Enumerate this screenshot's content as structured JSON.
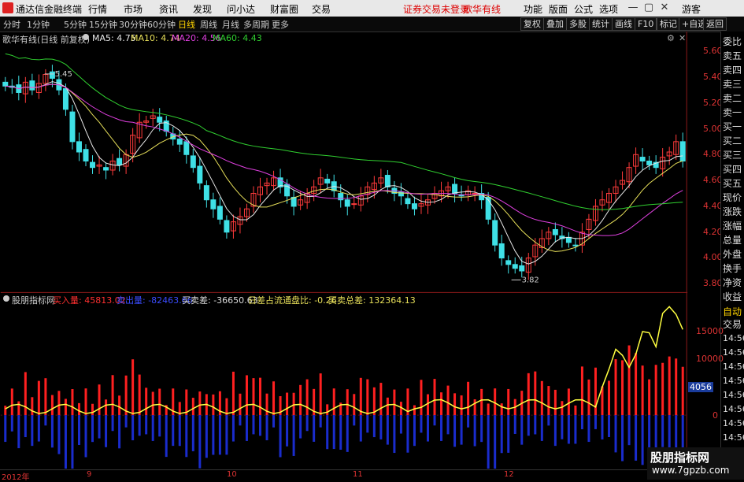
{
  "menubar": {
    "app_title": "通达信金融终端",
    "menus": [
      "行情",
      "市场",
      "资讯",
      "发现",
      "问小达",
      "财富圈",
      "交易"
    ],
    "notice": "证券交易未登录",
    "stock_name": "歌华有线",
    "right_menus": [
      "功能",
      "版面",
      "公式",
      "选项"
    ],
    "user": "游客"
  },
  "periodbar": {
    "periods": [
      "分时",
      "1分钟",
      "5分钟",
      "15分钟",
      "30分钟",
      "60分钟",
      "日线",
      "周线",
      "月线",
      "多周期",
      "更多"
    ],
    "active": "日线",
    "tools": [
      "复权",
      "叠加",
      "多股",
      "统计",
      "画线",
      "F10",
      "标记",
      "+自选",
      "返回"
    ]
  },
  "main_legend": {
    "title": "歌华有线(日线 前复权)",
    "ma5": "MA5: 4.75",
    "ma10": "MA10: 4.74",
    "ma20": "MA20: 4.56",
    "ma60": "MA60: 4.43",
    "high_label": "5.45",
    "low_label": "3.82"
  },
  "price_axis": [
    "5.60",
    "5.40",
    "5.20",
    "5.00",
    "4.80",
    "4.60",
    "4.40",
    "4.20",
    "4.00",
    "3.80"
  ],
  "right_panel": [
    "委比",
    "卖五",
    "卖四",
    "卖三",
    "卖二",
    "卖一",
    "买一",
    "买二",
    "买三",
    "买四",
    "买五",
    "现价",
    "涨跌",
    "涨幅",
    "总量",
    "外盘",
    "换手",
    "净资",
    "收益"
  ],
  "right_panel2": {
    "auto": "自动",
    "trade": "交易",
    "times": [
      "14:56",
      "14:56",
      "14:56",
      "14:56",
      "14:56",
      "14:56",
      "14:56",
      "14:56"
    ]
  },
  "indicator_legend": {
    "name": "股朋指标网",
    "buy": "买入量: 45813.02",
    "sell": "卖出量: -82463.66",
    "diff": "买卖差: -36650.63",
    "ratio": "日差占流通盘比: -0.26",
    "total": "买卖总差: 132364.13"
  },
  "indicator_axis": [
    "15000",
    "10000",
    "4056",
    "0"
  ],
  "date_axis": [
    "2012年",
    "9",
    "10",
    "11",
    "12"
  ],
  "watermark": {
    "line1": "股朋指标网",
    "line2": "www.7gpzb.com"
  },
  "colors": {
    "up": "#ff3b3b",
    "down": "#3fe0e6",
    "ma5": "#e8e8e8",
    "ma10": "#e8e05a",
    "ma20": "#e040e0",
    "ma60": "#30d030",
    "buy": "#ff2020",
    "sell": "#1a2ccc",
    "total": "#ffff40",
    "axis": "#d33"
  },
  "chart_data": {
    "type": "candlestick",
    "closes": [
      5.33,
      5.32,
      5.28,
      5.36,
      5.3,
      5.35,
      5.42,
      5.39,
      5.3,
      5.15,
      4.9,
      4.82,
      4.75,
      4.7,
      4.72,
      4.68,
      4.75,
      4.72,
      4.8,
      4.95,
      5.05,
      5.06,
      5.1,
      5.05,
      4.98,
      4.92,
      4.88,
      4.8,
      4.7,
      4.58,
      4.45,
      4.38,
      4.3,
      4.2,
      4.28,
      4.32,
      4.38,
      4.5,
      4.55,
      4.58,
      4.62,
      4.55,
      4.48,
      4.4,
      4.45,
      4.5,
      4.55,
      4.62,
      4.58,
      4.52,
      4.45,
      4.4,
      4.42,
      4.48,
      4.55,
      4.58,
      4.62,
      4.55,
      4.5,
      4.48,
      4.42,
      4.38,
      4.42,
      4.45,
      4.5,
      4.52,
      4.55,
      4.5,
      4.48,
      4.52,
      4.5,
      4.45,
      4.3,
      4.1,
      4.0,
      3.95,
      3.92,
      3.9,
      4.0,
      4.1,
      4.15,
      4.2,
      4.18,
      4.15,
      4.12,
      4.1,
      4.2,
      4.3,
      4.4,
      4.45,
      4.5,
      4.55,
      4.6,
      4.7,
      4.8,
      4.75,
      4.72,
      4.7,
      4.78,
      4.82,
      4.9,
      4.75
    ],
    "ma20_end": 4.56,
    "ma60_end": 4.43
  }
}
